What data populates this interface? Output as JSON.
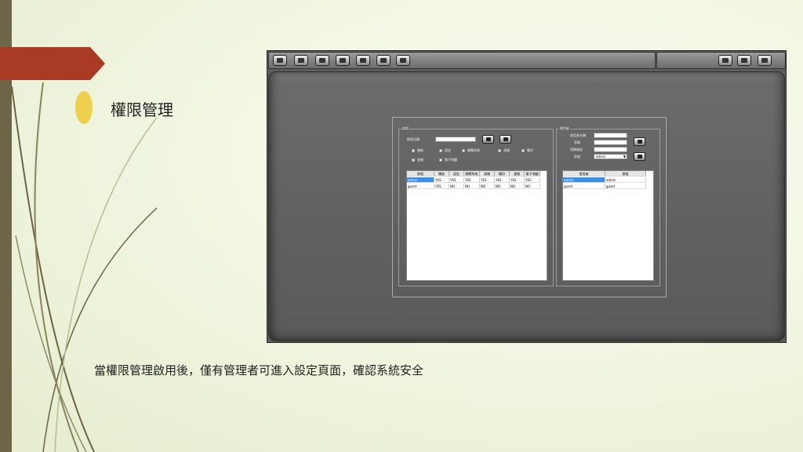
{
  "slide": {
    "title": "權限管理",
    "caption": "當權限管理啟用後，僅有管理者可進入設定頁面，確認系統安全"
  },
  "app": {
    "toolbar_icons": [
      "live-view-icon",
      "playback-icon",
      "setup-icon",
      "backup-icon",
      "search-icon",
      "log-icon",
      "screen-icon"
    ],
    "toolbar_right_icons": [
      "minimize-icon",
      "restore-icon",
      "power-icon"
    ],
    "group_left": {
      "label": "群組",
      "name_label": "群組名稱",
      "name_value": "",
      "permissions": [
        "播放",
        "設定",
        "開關系統",
        "遠端",
        "備份",
        "週報",
        "電子地圖"
      ],
      "table": {
        "headers": [
          "群組",
          "播放",
          "設定",
          "開關系統",
          "遠端",
          "備份",
          "週報",
          "電子地圖"
        ],
        "rows": [
          {
            "cells": [
              "admin",
              "YES",
              "YES",
              "YES",
              "YES",
              "YES",
              "YES",
              "YES"
            ],
            "selected": true
          },
          {
            "cells": [
              "guest",
              "YES",
              "NO",
              "NO",
              "NO",
              "NO",
              "NO",
              "NO"
            ],
            "selected": false
          }
        ]
      }
    },
    "group_right": {
      "label": "使用者",
      "user_label": "使用者名稱",
      "password_label": "密碼",
      "confirm_label": "密碼確認",
      "group_label": "群組",
      "group_value": "admin",
      "table": {
        "headers": [
          "使用者",
          "群組"
        ],
        "rows": [
          {
            "cells": [
              "admin",
              "admin"
            ],
            "selected": true
          },
          {
            "cells": [
              "guest",
              "guest"
            ],
            "selected": false
          }
        ]
      }
    }
  },
  "colors": {
    "accent_red": "#a93a24",
    "bullet_yellow": "#efd04e",
    "left_bar": "#6e6649",
    "selection_blue": "#3a8ee6"
  }
}
